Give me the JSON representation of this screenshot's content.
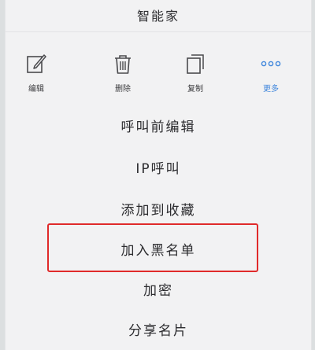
{
  "header": {
    "title": "智能家"
  },
  "actions": [
    {
      "label": "编辑",
      "icon": "edit-icon"
    },
    {
      "label": "删除",
      "icon": "trash-icon"
    },
    {
      "label": "复制",
      "icon": "copy-icon"
    },
    {
      "label": "更多",
      "icon": "more-dots-icon"
    }
  ],
  "menu": {
    "items": [
      {
        "label": "呼叫前编辑"
      },
      {
        "label": "IP呼叫"
      },
      {
        "label": "添加到收藏"
      },
      {
        "label": "加入黑名单"
      },
      {
        "label": "加密"
      },
      {
        "label": "分享名片"
      }
    ]
  },
  "colors": {
    "accent": "#3f86dc",
    "highlight": "#e02a2a",
    "background": "#f2f2f3"
  }
}
